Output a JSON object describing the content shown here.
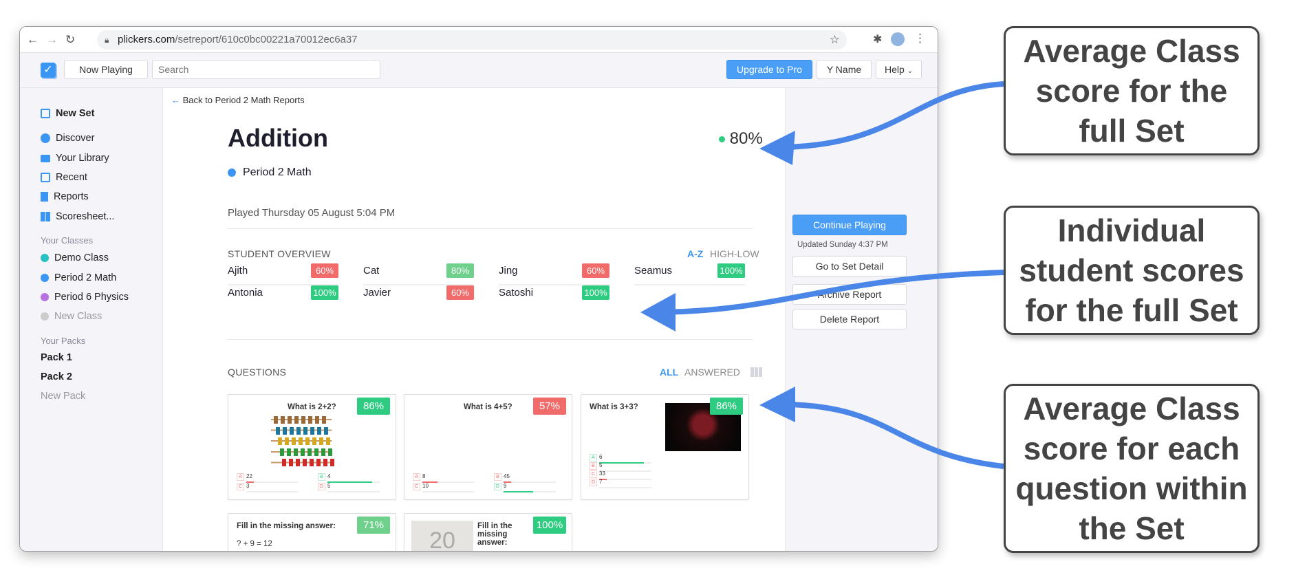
{
  "browser": {
    "url_domain": "plickers.com",
    "url_path": "/setreport/610c0bc00221a70012ec6a37"
  },
  "header": {
    "now_playing": "Now Playing",
    "search_placeholder": "Search",
    "upgrade": "Upgrade to Pro",
    "user": "Y Name",
    "help": "Help"
  },
  "sidebar": {
    "new_set": "New Set",
    "nav": [
      "Discover",
      "Your Library",
      "Recent",
      "Reports",
      "Scoresheet..."
    ],
    "classes_heading": "Your Classes",
    "classes": [
      {
        "name": "Demo Class",
        "color": "#28c1c1"
      },
      {
        "name": "Period 2 Math",
        "color": "#3b95f2"
      },
      {
        "name": "Period 6 Physics",
        "color": "#b673e0"
      }
    ],
    "new_class": "New Class",
    "packs_heading": "Your Packs",
    "packs": [
      "Pack 1",
      "Pack 2"
    ],
    "new_pack": "New Pack"
  },
  "report": {
    "back": "Back to Period 2 Math Reports",
    "title": "Addition",
    "score": "80%",
    "class": "Period 2 Math",
    "class_color": "#3b95f2",
    "played": "Played Thursday 05 August 5:04 PM",
    "overview_heading": "STUDENT OVERVIEW",
    "sort_az": "A-Z",
    "sort_hl": "HIGH-LOW",
    "students": [
      {
        "name": "Ajith",
        "score": "60%",
        "color": "#f06b69"
      },
      {
        "name": "Cat",
        "score": "80%",
        "color": "#6fd08c"
      },
      {
        "name": "Jing",
        "score": "60%",
        "color": "#f06b69"
      },
      {
        "name": "Seamus",
        "score": "100%",
        "color": "#2ecc80"
      },
      {
        "name": "Antonia",
        "score": "100%",
        "color": "#2ecc80"
      },
      {
        "name": "Javier",
        "score": "60%",
        "color": "#f06b69"
      },
      {
        "name": "Satoshi",
        "score": "100%",
        "color": "#2ecc80"
      }
    ],
    "questions_heading": "QUESTIONS",
    "filter_all": "ALL",
    "filter_answered": "ANSWERED",
    "questions": [
      {
        "text": "What is 2+2?",
        "score": "86%",
        "color": "#2ecc80",
        "choices": [
          {
            "letter": "A",
            "text": "22",
            "fraction": 0.14,
            "correct": false
          },
          {
            "letter": "B",
            "text": "4",
            "fraction": 0.86,
            "correct": true
          },
          {
            "letter": "C",
            "text": "3",
            "fraction": 0,
            "correct": false
          },
          {
            "letter": "D",
            "text": "5",
            "fraction": 0,
            "correct": false
          }
        ]
      },
      {
        "text": "What is 4+5?",
        "score": "57%",
        "color": "#f06b69",
        "choices": [
          {
            "letter": "A",
            "text": "8",
            "fraction": 0.29,
            "correct": false
          },
          {
            "letter": "B",
            "text": "45",
            "fraction": 0.14,
            "correct": false
          },
          {
            "letter": "C",
            "text": "10",
            "fraction": 0,
            "correct": false
          },
          {
            "letter": "D",
            "text": "9",
            "fraction": 0.57,
            "correct": true
          }
        ]
      },
      {
        "text": "What is 3+3?",
        "score": "86%",
        "color": "#2ecc80",
        "choices": [
          {
            "letter": "A",
            "text": "6",
            "fraction": 0.86,
            "correct": true
          },
          {
            "letter": "B",
            "text": "5",
            "fraction": 0,
            "correct": false
          },
          {
            "letter": "C",
            "text": "33",
            "fraction": 0.14,
            "correct": false
          },
          {
            "letter": "D",
            "text": "7",
            "fraction": 0,
            "correct": false
          }
        ]
      },
      {
        "text": "Fill in the missing answer:",
        "body": "? + 9 = 12",
        "score": "71%",
        "color": "#6fd08c"
      },
      {
        "text": "Fill in the missing answer:",
        "score": "100%",
        "color": "#2ecc80",
        "image_text": "20"
      }
    ]
  },
  "actions": {
    "continue": "Continue Playing",
    "updated": "Updated Sunday 4:37 PM",
    "detail": "Go to Set Detail",
    "archive": "Archive Report",
    "delete": "Delete Report"
  },
  "callouts": [
    "Average Class score for the full Set",
    "Individual student scores for the full Set",
    "Average Class score for each question within the Set"
  ],
  "colors": {
    "accent": "#3b95f2",
    "arrow": "#4a86e8"
  }
}
